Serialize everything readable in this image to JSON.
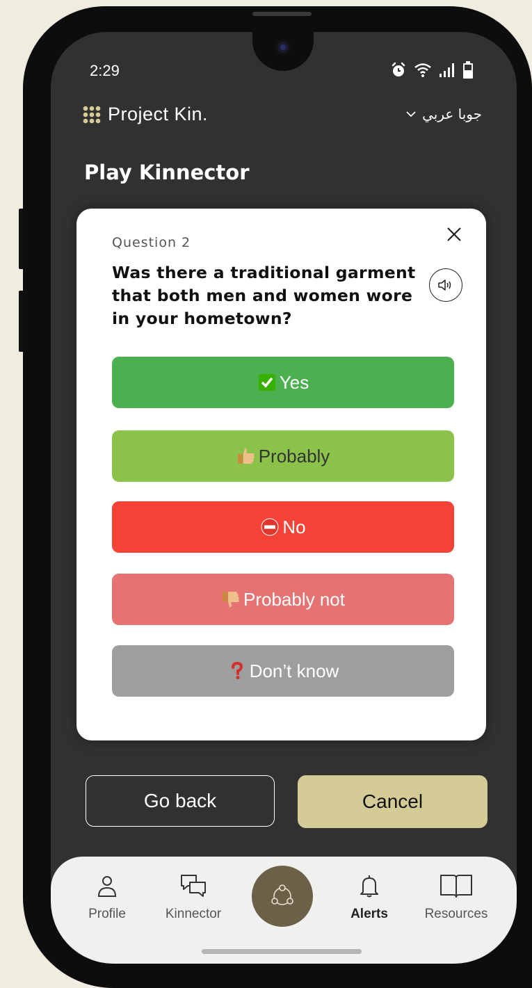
{
  "status": {
    "time": "2:29"
  },
  "header": {
    "brand": "Project Kin.",
    "language": "جوبا عربي"
  },
  "page": {
    "title": "Play Kinnector"
  },
  "question": {
    "number_label": "Question 2",
    "text": "Was there a traditional garment that both men and women wore in your hometown?",
    "answers": [
      {
        "label": "Yes",
        "icon": "check-box-icon",
        "color": "#4caf50"
      },
      {
        "label": "Probably",
        "icon": "thumbs-up-icon",
        "color": "#8bc34a"
      },
      {
        "label": "No",
        "icon": "no-entry-icon",
        "color": "#f44336"
      },
      {
        "label": "Probably not",
        "icon": "thumbs-down-icon",
        "color": "#e57373"
      },
      {
        "label": "Don’t know",
        "icon": "question-mark-icon",
        "color": "#9e9e9e"
      }
    ]
  },
  "actions": {
    "back_label": "Go back",
    "cancel_label": "Cancel"
  },
  "tabs": [
    {
      "label": "Profile",
      "icon": "person-icon"
    },
    {
      "label": "Kinnector",
      "icon": "chat-bubbles-icon"
    },
    {
      "label": "",
      "icon": "network-icon"
    },
    {
      "label": "Alerts",
      "icon": "bell-icon"
    },
    {
      "label": "Resources",
      "icon": "book-icon"
    }
  ],
  "colors": {
    "screen_bg": "#313131",
    "accent": "#d5cb96",
    "center_tab": "#6b6148"
  }
}
